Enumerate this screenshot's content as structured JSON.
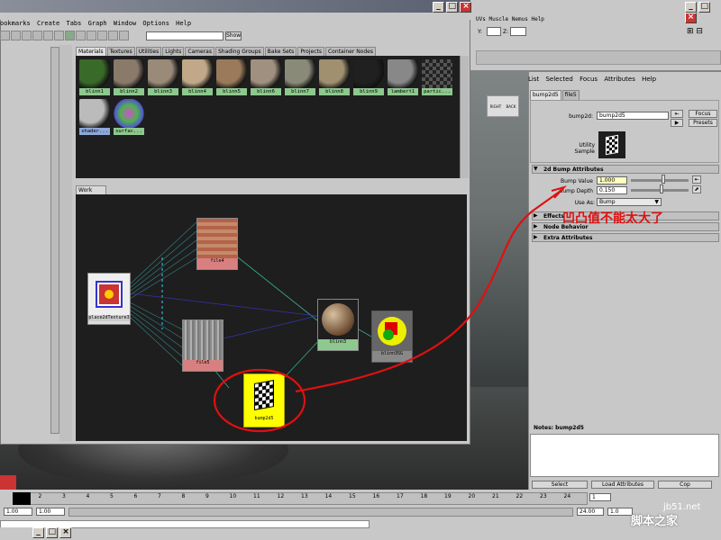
{
  "maya_menubar": [
    "UVs",
    "Muscle",
    "Nemus",
    "Help"
  ],
  "coord_labels": {
    "y": "Y:",
    "z": "Z:"
  },
  "hypershade": {
    "menus": [
      "ookmarks",
      "Create",
      "Tabs",
      "Graph",
      "Window",
      "Options",
      "Help"
    ],
    "show_button": "Show",
    "tabs": [
      "Materials",
      "Textures",
      "Utilities",
      "Lights",
      "Cameras",
      "Shading Groups",
      "Bake Sets",
      "Projects",
      "Container Nodes"
    ],
    "swatches": [
      {
        "label": "blinn1",
        "color": "#3a6a2a"
      },
      {
        "label": "blinn2",
        "color": "#8a7a6a"
      },
      {
        "label": "blinn3",
        "color": "#9a8a78"
      },
      {
        "label": "blinn4",
        "color": "#c0a888"
      },
      {
        "label": "blinn5",
        "color": "#9a7a5a"
      },
      {
        "label": "blinn6",
        "color": "#a09080"
      },
      {
        "label": "blinn7",
        "color": "#8a8a78"
      },
      {
        "label": "blinn8",
        "color": "#a09070"
      },
      {
        "label": "blinn9",
        "color": "#202020"
      },
      {
        "label": "lambert1",
        "color": "#888888"
      },
      {
        "label": "partic...",
        "color": "#333"
      },
      {
        "label": "shader...",
        "color": "#bbbbbb"
      },
      {
        "label": "surfac...",
        "color": "#7a5ab0"
      }
    ],
    "work_area_tab": "Work Area",
    "nodes": {
      "file4": "file4",
      "file5": "file5",
      "place2d": "place2dTexture3",
      "blinn3": "blinn3",
      "blinn3sg": "blinn3SG",
      "bump2d5": "bump2d5"
    },
    "left_scroll_label": ">>"
  },
  "attribute_editor": {
    "menus": [
      "List",
      "Selected",
      "Focus",
      "Attributes",
      "Help"
    ],
    "tabs": [
      "bump2d5",
      "file5"
    ],
    "node_label": "bump2d:",
    "node_value": "bump2d5",
    "focus_button": "Focus",
    "presets_button": "Presets",
    "utility_sample_label": "Utility Sample",
    "section_bump": "2d Bump Attributes",
    "bump_value_label": "Bump Value",
    "bump_value": "1.000",
    "bump_depth_label": "Bump Depth",
    "bump_depth": "0.150",
    "use_as_label": "Use As:",
    "use_as_value": "Bump",
    "section_effects": "Effects",
    "section_node_behavior": "Node Behavior",
    "section_extra": "Extra Attributes",
    "notes_label": "Notes:",
    "notes_value": "bump2d5",
    "select_button": "Select",
    "load_attributes_button": "Load Attributes",
    "copy_tab_button": "Cop"
  },
  "viewcube_labels": {
    "right": "RIGHT",
    "back": "BACK"
  },
  "timeline": {
    "ticks": [
      "1",
      "2",
      "3",
      "4",
      "5",
      "6",
      "7",
      "8",
      "9",
      "10",
      "11",
      "12",
      "13",
      "14",
      "15",
      "16",
      "17",
      "18",
      "19",
      "20",
      "21",
      "22",
      "23",
      "24"
    ],
    "current_frame": "1",
    "range_start": "1.00",
    "range_start2": "1.00",
    "range_end": "24.00",
    "range_right": "1.0"
  },
  "annotation": "凹凸值不能太大了",
  "watermark": {
    "url": "jb51.net",
    "text": "脚本之家"
  },
  "colors": {
    "annotation_red": "#e01010",
    "label_green": "#8ec88e",
    "label_blue": "#8ea8d8",
    "node_red": "#d88080"
  }
}
